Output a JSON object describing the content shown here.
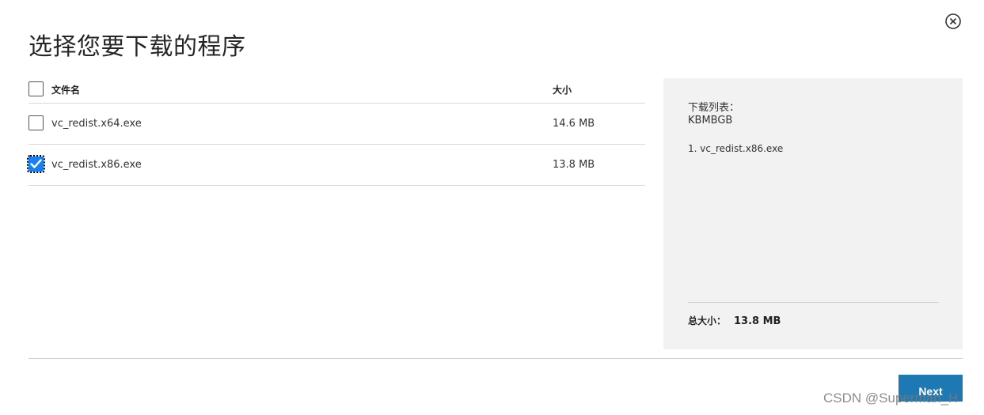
{
  "dialog": {
    "title": "选择您要下载的程序"
  },
  "table": {
    "header": {
      "name": "文件名",
      "size": "大小"
    },
    "rows": [
      {
        "name": "vc_redist.x64.exe",
        "size": "14.6 MB",
        "checked": false
      },
      {
        "name": "vc_redist.x86.exe",
        "size": "13.8 MB",
        "checked": true
      }
    ]
  },
  "summary": {
    "heading": "下载列表：",
    "units": "KBMBGB",
    "items": [
      "1. vc_redist.x86.exe"
    ],
    "total_label": "总大小：",
    "total_value": "13.8 MB"
  },
  "footer": {
    "next_label": "Next"
  },
  "watermark": "CSDN @Superman_H",
  "colors": {
    "checkbox_checked": "#1a7ff0",
    "next_button": "#1e78b4",
    "summary_bg": "#f2f2f2"
  },
  "icons": {
    "close": "close-circle-icon",
    "check": "checkmark-icon"
  }
}
